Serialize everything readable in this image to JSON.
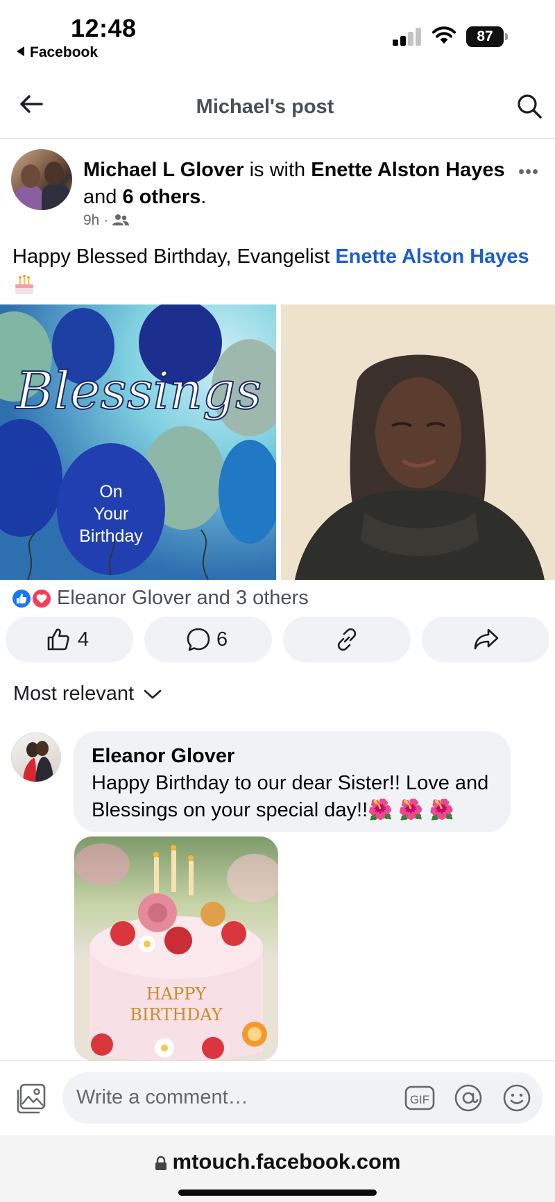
{
  "status": {
    "time": "12:48",
    "back_app": "Facebook",
    "battery": "87"
  },
  "header": {
    "title": "Michael's post"
  },
  "post": {
    "author": "Michael L Glover",
    "with_word": "is with",
    "tagged": "Enette Alston Hayes",
    "and_word": "and",
    "others": "6 others",
    "period": ".",
    "time": "9h",
    "text_prefix": "Happy Blessed Birthday, Evangelist",
    "text_mention": "Enette Alston Hayes",
    "image_left_words": [
      "Blessings",
      "On",
      "Your",
      "Birthday"
    ]
  },
  "reactions": {
    "summary": "Eleanor Glover and 3 others"
  },
  "actions": {
    "likes": "4",
    "comments": "6"
  },
  "sort": {
    "label": "Most relevant"
  },
  "comment": {
    "author": "Eleanor Glover",
    "text": "Happy Birthday to our dear Sister!! Love and Blessings on your special day!!🌺 🌺 🌺",
    "image_text": [
      "HAPPY",
      "BIRTHDAY"
    ]
  },
  "composer": {
    "placeholder": "Write a comment…",
    "gif": "GIF"
  },
  "browser": {
    "url": "mtouch.facebook.com"
  },
  "colors": {
    "brand": "#1b5fc7",
    "like_blue": "#1877f2",
    "love_red": "#f33e58",
    "bubble": "#f0f2f5"
  }
}
